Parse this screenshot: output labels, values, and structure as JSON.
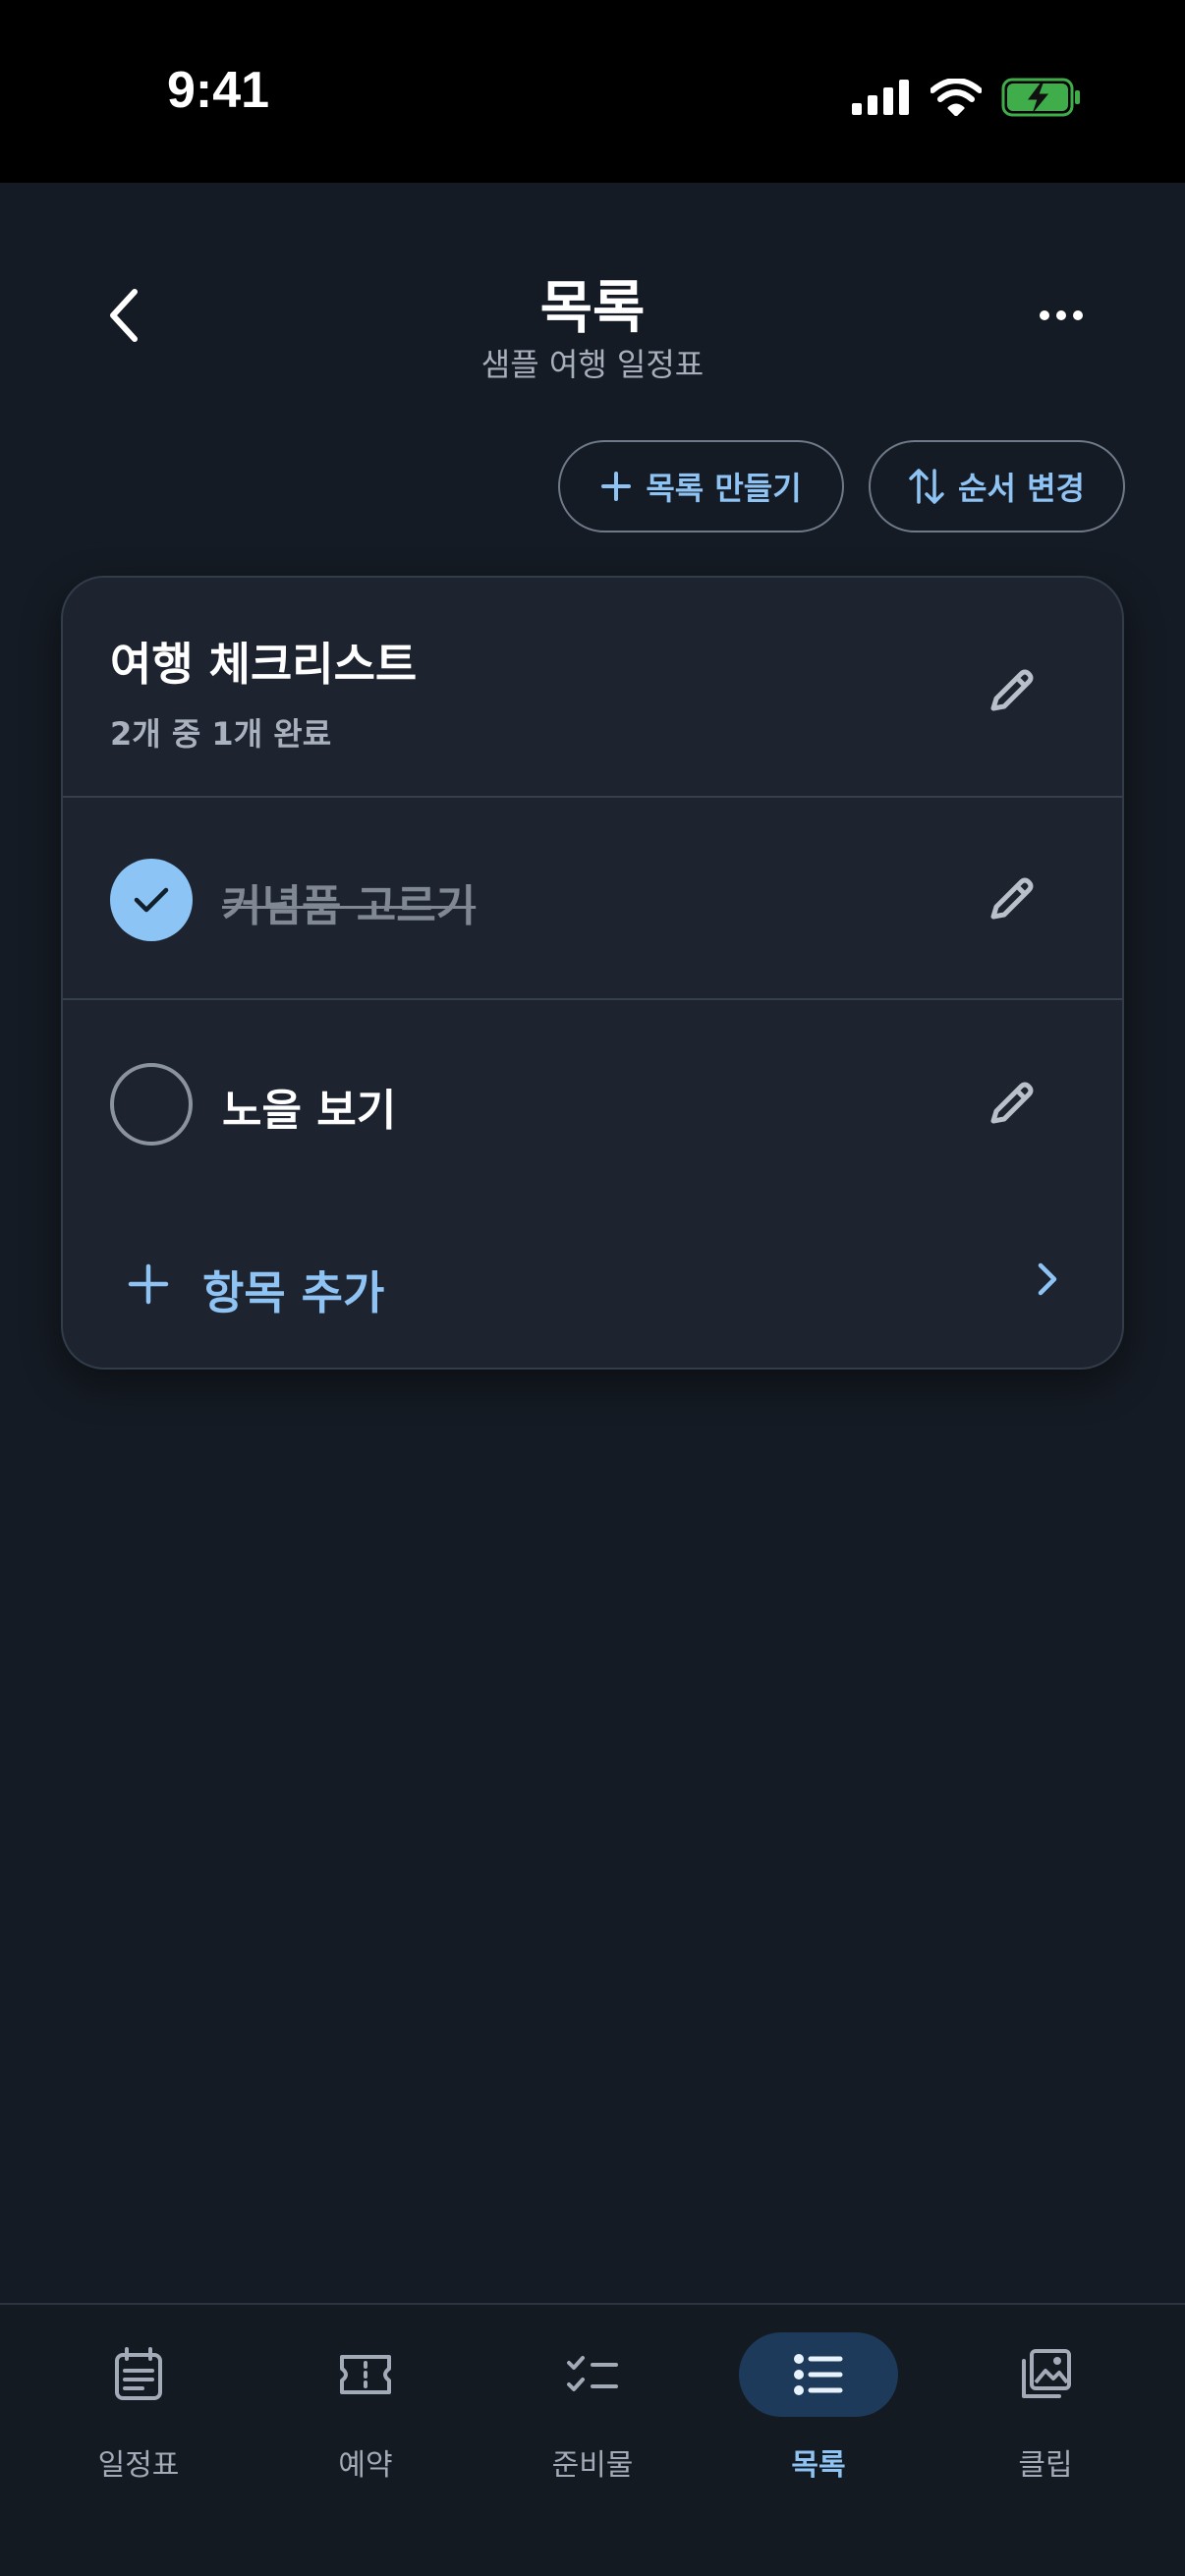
{
  "status_bar": {
    "time": "9:41"
  },
  "header": {
    "title": "목록",
    "subtitle": "샘플 여행 일정표"
  },
  "actions": {
    "create_label": "목록 만들기",
    "reorder_label": "순서 변경"
  },
  "list": {
    "title": "여행 체크리스트",
    "progress": "2개 중 1개 완료",
    "items": [
      {
        "label": "커념품 고르기",
        "done": true
      },
      {
        "label": "노을 보기",
        "done": false
      }
    ],
    "add_item_label": "항목 추가"
  },
  "bottom_nav": {
    "items": [
      {
        "label": "일정표",
        "icon": "schedule-icon"
      },
      {
        "label": "예약",
        "icon": "ticket-icon"
      },
      {
        "label": "준비물",
        "icon": "checklist-icon"
      },
      {
        "label": "목록",
        "icon": "list-icon",
        "active": true
      },
      {
        "label": "클립",
        "icon": "gallery-icon"
      }
    ]
  },
  "colors": {
    "background": "#151b24",
    "card": "#1d2430",
    "accent": "#8ec3f3",
    "active_nav_bg": "#1d3a5a"
  }
}
